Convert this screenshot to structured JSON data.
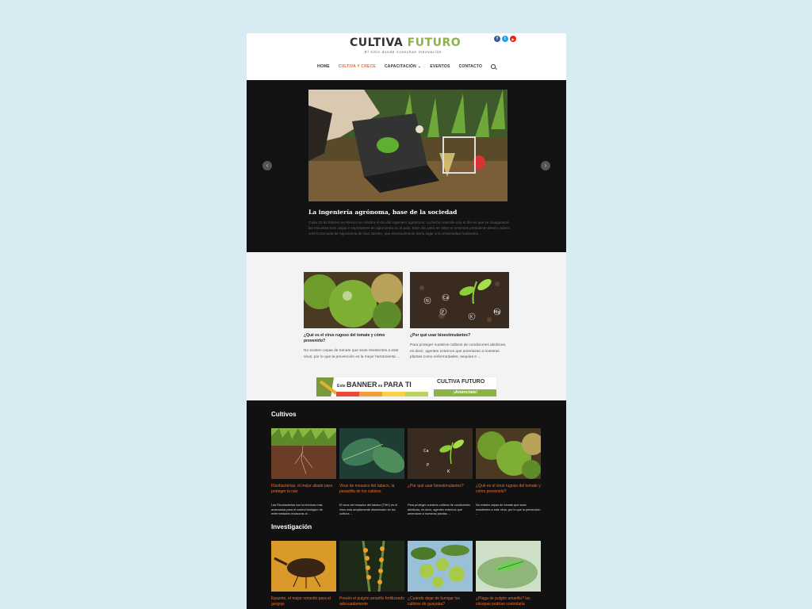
{
  "site": {
    "logo_main": "CULTIVA ",
    "logo_accent": "FUTURO",
    "tagline": "El sitio donde cosechas innovación"
  },
  "socials": [
    {
      "icon": "facebook-icon",
      "glyph": "f",
      "color": "#3b5998"
    },
    {
      "icon": "twitter-icon",
      "glyph": "t",
      "color": "#1da1f2"
    },
    {
      "icon": "youtube-icon",
      "glyph": "▶",
      "color": "#e62117"
    }
  ],
  "nav": {
    "items": [
      "HOME",
      "CULTIVA Y CRECE",
      "CAPACITACIÓN",
      "EVENTOS",
      "CONTACTO"
    ],
    "active": "CULTIVA Y CRECE"
  },
  "hero": {
    "title": "La ingeniería agrónoma, base de la sociedad",
    "excerpt": "Cada 22 de febrero en México se celebra el día del ingeniero agrónomo. La fecha coincide con el día en que se inauguraron las escuelas más viejas e importantes de agronomía en el país. Este día, pero en 1854 el entonces presidente Benito Juárez creó la Escuela de Agronomía de San Jacinto, que eventualmente daría lugar a la Universidad Autónoma ...",
    "prev_glyph": "‹",
    "next_glyph": "›"
  },
  "featured": [
    {
      "title": "¿Qué es el virus rugoso del tomate y cómo prevenirlo?",
      "excerpt": "No existen cepas de tomate que sean resistentes a este virus, por lo que la prevención es la mejor herramienta ..."
    },
    {
      "title": "¿Por qué usar bioestimulantes?",
      "excerpt": "Para proteger nuestros cultivos de condiciones abióticas, es decir, agentes externos que amenazan a nuestras plantas como enfermedades, sequías e ..."
    }
  ],
  "banner": {
    "pre": "Este ",
    "main": "BANNER",
    "mid": " es ",
    "end": "PARA TI",
    "logo": "CULTIVA FUTURO",
    "cta": "¡Anúnciate!"
  },
  "sections": [
    {
      "title": "Cultivos",
      "posts": [
        {
          "title": "Rizobacterias, el mejor aliado para proteger la raíz",
          "excerpt": "Las Rizobacterias son la técnicas más avanzadas para el control biológico de enfermedades invasoras al ..."
        },
        {
          "title": "Virus de mosaico del tabaco, la pesadilla de los cultivos",
          "excerpt": "El virus del mosaico del tabaco (TMV) es el virus más ampliamente diseminado en los cultivos ..."
        },
        {
          "title": "¿Por qué usar bioestimulantes?",
          "excerpt": "Para proteger nuestros cultivos de condiciones abióticas, es decir, agentes externos que amenazan a nuestras plantas ..."
        },
        {
          "title": "¿Qué es el virus rugoso del tomate y cómo prevenirlo?",
          "excerpt": "No existen cepas de tomate que sean resistentes a este virus, por lo que la prevención ..."
        }
      ]
    },
    {
      "title": "Investigación",
      "posts": [
        {
          "title": "Epazote, el mejor remedio para el gorgojo",
          "excerpt": ""
        },
        {
          "title": "Prevén el pulgón amarillo fertilizando adecuadamente",
          "excerpt": ""
        },
        {
          "title": "¿Cuándo dejar de fumigar los cultivos de guayaba?",
          "excerpt": ""
        },
        {
          "title": "¿Plaga de pulgón amarillo? las crisopas podrían controlarla",
          "excerpt": ""
        }
      ]
    }
  ]
}
